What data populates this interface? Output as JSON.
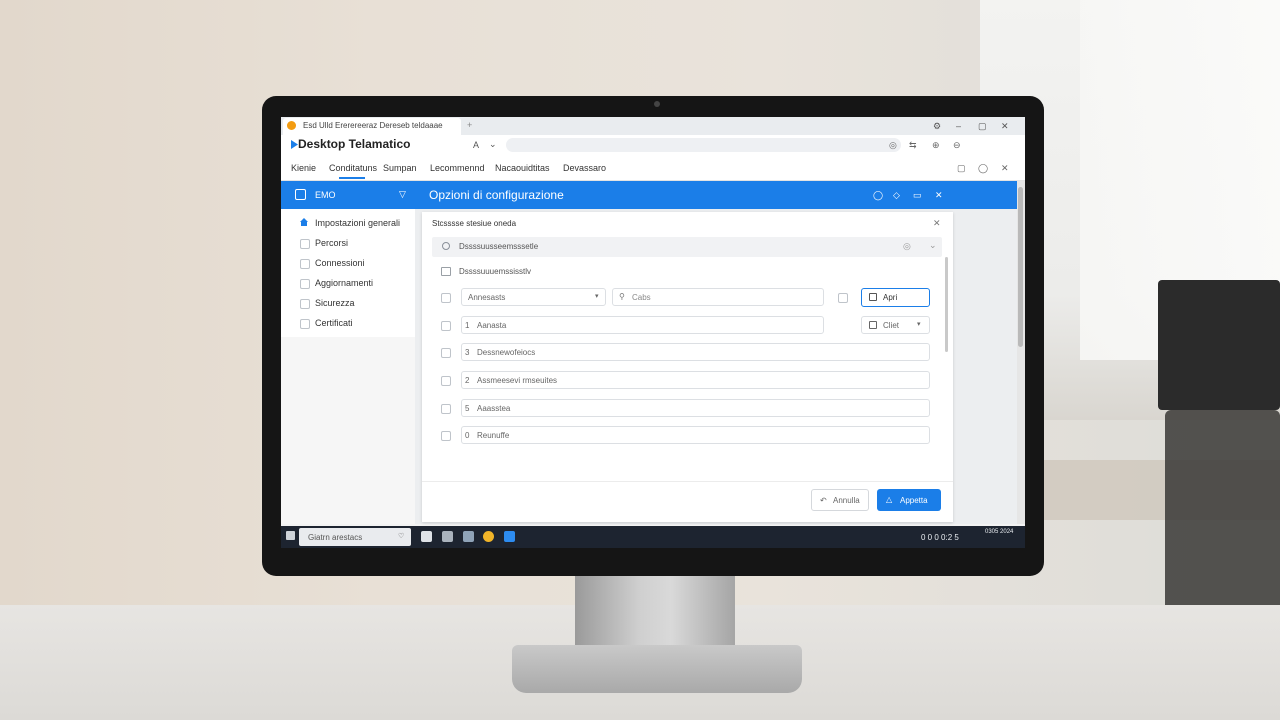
{
  "browser": {
    "tab_text": "Esd   Ulld   Ererereeraz   Dereseb teldaaae",
    "tab_icon": "warning-icon",
    "tab_add": "+",
    "win_controls": [
      "⚙",
      "–",
      "▢",
      "✕"
    ],
    "addr_icons": [
      "A",
      "⌄"
    ],
    "url_right_icons": [
      "◎",
      "⇆",
      "⊕",
      "⊖"
    ]
  },
  "app": {
    "title": "Desktop Telamatico",
    "menu": [
      "Kienie",
      "Conditatuns",
      "Sumpan",
      "Lecommennd",
      "Nacaouidtitas",
      "Devassaro"
    ],
    "menu_active_index": 1,
    "menu_right_icons": [
      "▢",
      "◯",
      "✕"
    ]
  },
  "header": {
    "left_label": "EMO",
    "title": "Opzioni di configurazione",
    "icons": [
      "◯",
      "◇",
      "▭",
      "✕"
    ]
  },
  "sidebar": {
    "items": [
      {
        "label": "Impostazioni generali",
        "icon": "home-icon"
      },
      {
        "label": "Percorsi",
        "icon": "checkbox-icon"
      },
      {
        "label": "Connessioni",
        "icon": "checkbox-icon"
      },
      {
        "label": "Aggiornamenti",
        "icon": "checkbox-icon"
      },
      {
        "label": "Sicurezza",
        "icon": "checkbox-icon"
      },
      {
        "label": "Certificati",
        "icon": "checkbox-icon"
      }
    ]
  },
  "panel": {
    "title": "Stcsssse stesiue oneda",
    "section_label": "Dssssuusseemsssetle",
    "section_icons": [
      "◎",
      "⌄"
    ],
    "subsection_label": "Dssssuuuemssisstlv",
    "dropdown_value": "Annesasts",
    "search_placeholder": "Cabs",
    "open_button": "Apri",
    "client_button": "Cliet",
    "rows": [
      {
        "num": "1",
        "text": "Aanasta"
      },
      {
        "num": "3",
        "text": "Dessnewofeiocs"
      },
      {
        "num": "2",
        "text": "Assmeesevi rmseuites"
      },
      {
        "num": "5",
        "text": "Aaasstea"
      },
      {
        "num": "0",
        "text": "Reunuffe"
      }
    ],
    "cancel_label": "Annulla",
    "apply_label": "Appetta"
  },
  "taskbar": {
    "search_text": "Giatrn arestacs",
    "clock": "0 0 0 0:2 5",
    "date": "0305 2024"
  },
  "colors": {
    "accent": "#1b7ee8",
    "taskbar": "#1d2430"
  }
}
